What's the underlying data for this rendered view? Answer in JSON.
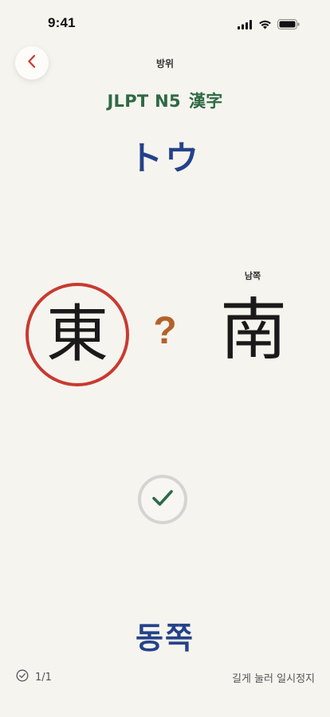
{
  "status_bar": {
    "time": "9:41"
  },
  "header": {
    "category": "방위",
    "level": "JLPT N5",
    "script": "漢字"
  },
  "card": {
    "reading": "トウ",
    "kanji_target": "東",
    "question_mark": "?",
    "kanji_compare": "南",
    "kanji_compare_hint": "남쪽",
    "meaning": "동쪽"
  },
  "footer": {
    "progress": "1/1",
    "pause_hint": "길게 눌러 일시정지"
  },
  "colors": {
    "background": "#f6f4ef",
    "level_green": "#2e6a44",
    "reading_blue": "#24428a",
    "circle_red": "#c83a30",
    "question_orange": "#b4612a",
    "check_green": "#2e6a44"
  },
  "icons": {
    "back": "chevron-left-icon",
    "check": "check-icon",
    "progress": "check-circle-icon"
  }
}
